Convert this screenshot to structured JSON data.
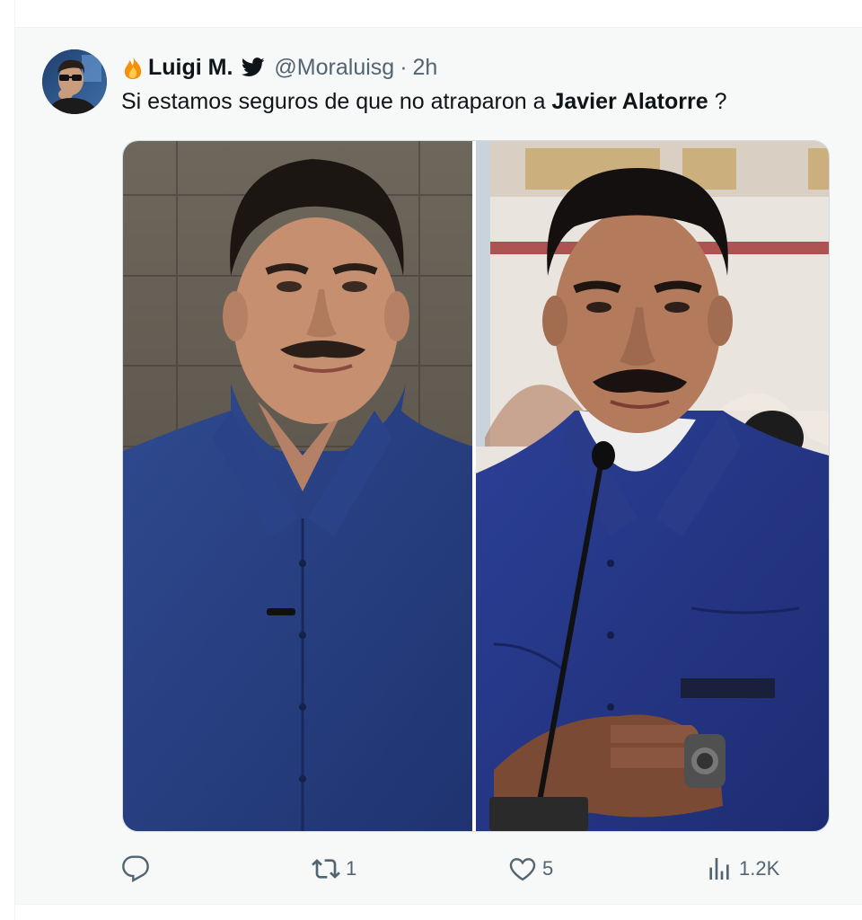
{
  "tweet": {
    "display_name": "Luigi M.",
    "handle": "@Moraluisg",
    "separator": "·",
    "time": "2h",
    "text_prefix": "Si estamos seguros de que no atraparon a ",
    "text_bold": "Javier Alatorre",
    "text_suffix": " ?",
    "icons": {
      "name_prefix": "fire-icon",
      "verified": "twitter-bird-icon",
      "reply": "reply-icon",
      "retweet": "retweet-icon",
      "like": "heart-icon",
      "views": "views-icon"
    },
    "media": {
      "images": [
        {
          "subject": "man-blue-shirt-left"
        },
        {
          "subject": "man-blue-shirt-microphone-right"
        }
      ]
    },
    "stats": {
      "replies": "",
      "retweets": "1",
      "likes": "5",
      "views": "1.2K"
    }
  },
  "colors": {
    "text": "#0f1419",
    "secondary": "#536471",
    "background": "#f7f9f9",
    "border": "#cfd9de",
    "verified_bird": "#0f1419",
    "fire": "#f4900c"
  }
}
